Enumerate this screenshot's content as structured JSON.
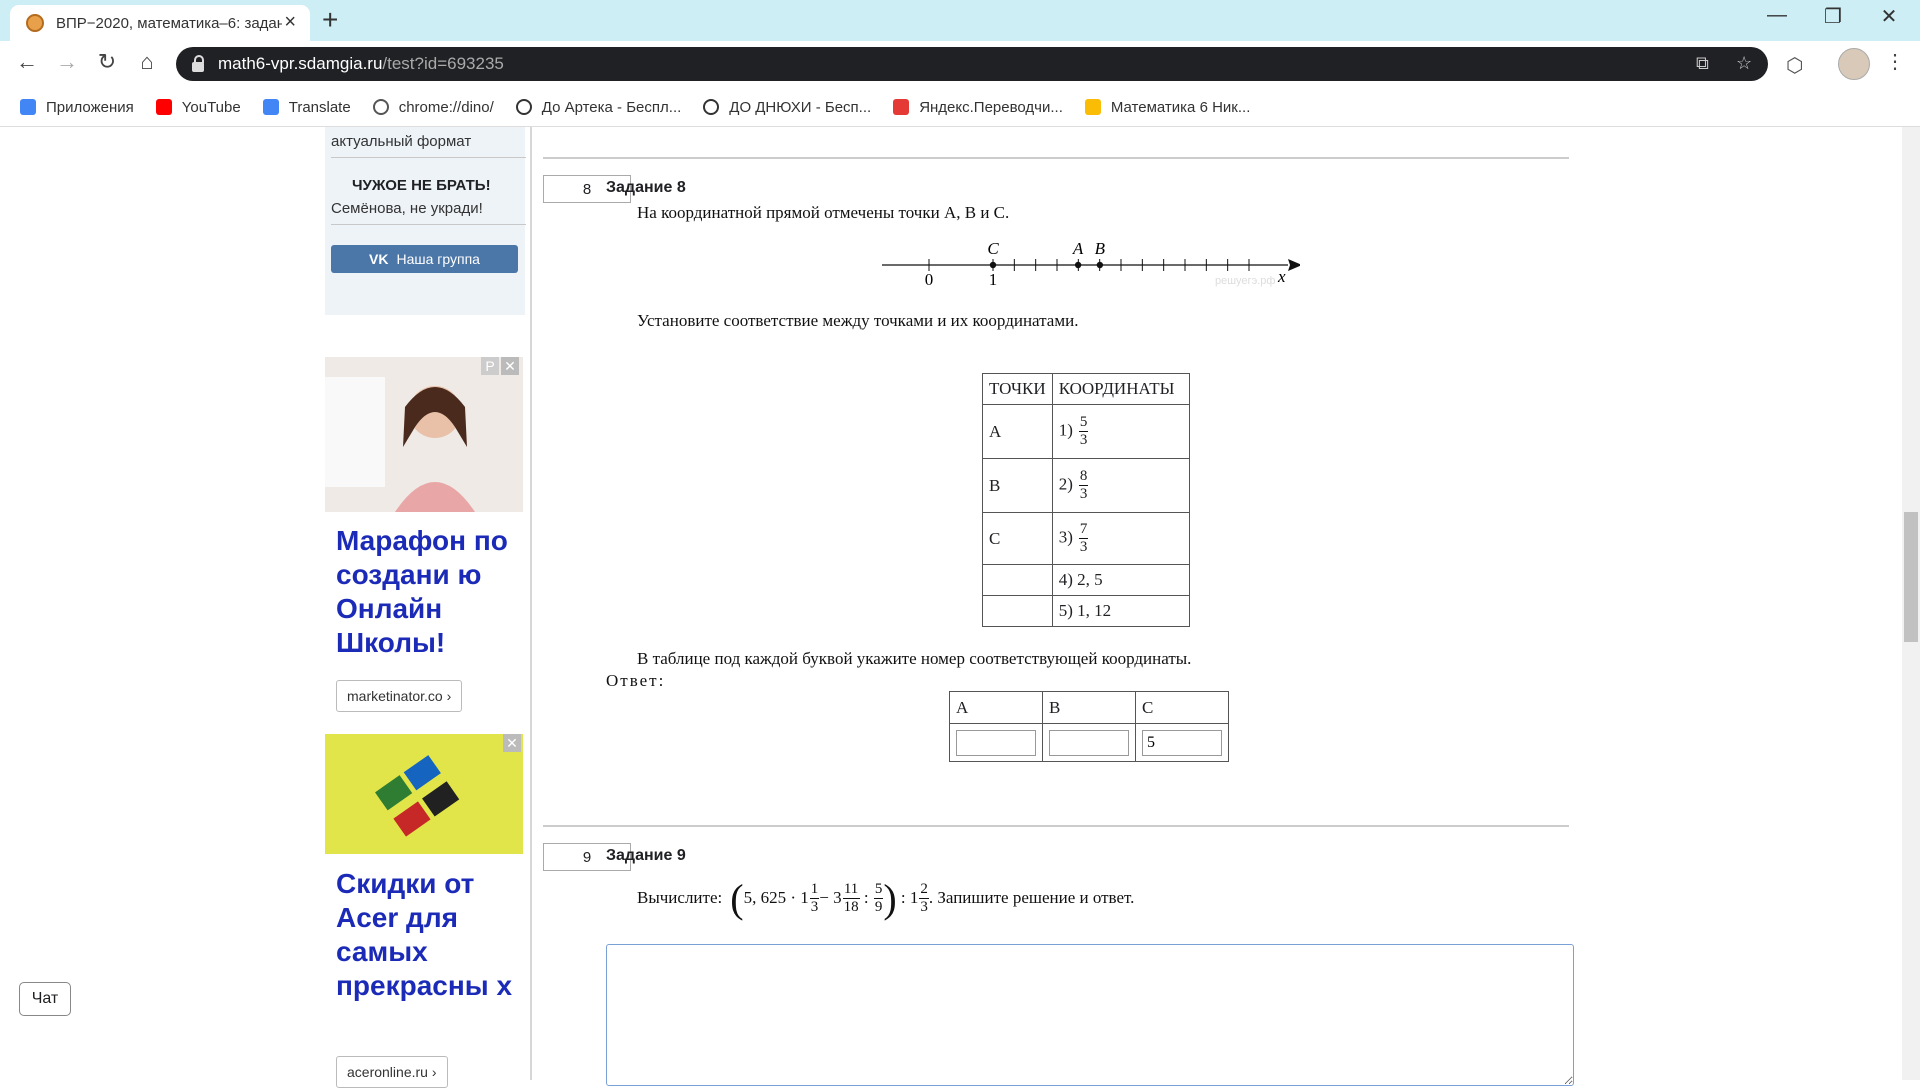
{
  "browser": {
    "tab_title": "ВПР−2020, математика–6: задан",
    "url_host": "math6-vpr.sdamgia.ru",
    "url_path": "/test?id=693235",
    "new_tab": "+",
    "window_min": "—",
    "window_max": "❐",
    "window_close": "✕",
    "bookmarks": [
      {
        "label": "Приложения",
        "color": "#4285f4"
      },
      {
        "label": "YouTube",
        "color": "#ff0000"
      },
      {
        "label": "Translate",
        "color": "#4285f4"
      },
      {
        "label": "chrome://dino/",
        "color": "#555555"
      },
      {
        "label": "До Артека - Беспл...",
        "color": "#333333"
      },
      {
        "label": "ДО ДНЮХИ - Бесп...",
        "color": "#333333"
      },
      {
        "label": "Яндекс.Переводчи...",
        "color": "#e53935"
      },
      {
        "label": "Математика 6 Ник...",
        "color": "#fbbc05"
      }
    ]
  },
  "sidebar": {
    "format_text": "актуальный формат",
    "warning_title": "ЧУЖОЕ НЕ БРАТЬ!",
    "warning_text": "Семёнова, не укради!",
    "vk_button": "Наша группа",
    "ad1": {
      "label_p": "P",
      "close": "✕",
      "headline": "Марафон по создани ю Онлайн Школы!",
      "link": "marketinator.co ›"
    },
    "ad2": {
      "close": "✕",
      "headline": "Скидки от Acer для самых прекрасны х",
      "link": "aceronline.ru ›"
    },
    "chat_button": "Чат"
  },
  "task8": {
    "number": "8",
    "title": "Задание 8",
    "intro": "На координатной прямой отмечены точки A, B и C.",
    "numberline": {
      "labels": {
        "zero": "0",
        "one": "1",
        "x": "x",
        "C": "C",
        "A": "A",
        "B": "B"
      },
      "watermark": "решуегэ.рф",
      "points": {
        "C": 1,
        "A": 2.33,
        "B": 2.67
      }
    },
    "instruction": "Установите соответствие между точками и их координатами.",
    "table_headers": [
      "ТОЧКИ",
      "КООРДИНАТЫ"
    ],
    "rows": [
      {
        "point": "A",
        "option": "1)",
        "num": "5",
        "den": "3"
      },
      {
        "point": "B",
        "option": "2)",
        "num": "8",
        "den": "3"
      },
      {
        "point": "C",
        "option": "3)",
        "num": "7",
        "den": "3"
      },
      {
        "point": "",
        "option": "4) 2, 5"
      },
      {
        "point": "",
        "option": "5) 1, 12"
      }
    ],
    "answer_note": "В таблице под каждой буквой укажите номер соответствующей координаты.",
    "answer_label": "Ответ:",
    "answer_headers": [
      "A",
      "B",
      "C"
    ],
    "answer_values": [
      "",
      "",
      "5"
    ]
  },
  "task9": {
    "number": "9",
    "title": "Задание 9",
    "prefix": "Вычислите:",
    "expr": {
      "a": "5, 625 · 1",
      "f1n": "1",
      "f1d": "3",
      "b": " − 3",
      "f2n": "11",
      "f2d": "18",
      "c": " : ",
      "f3n": "5",
      "f3d": "9",
      "d": " : 1",
      "f4n": "2",
      "f4d": "3"
    },
    "suffix": ". Запишите решение и ответ."
  }
}
